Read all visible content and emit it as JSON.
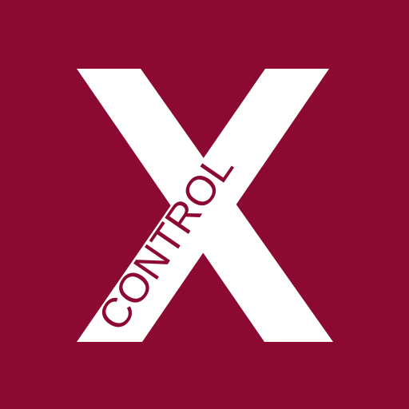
{
  "logo": {
    "word": "CONTROL",
    "background_color": "#8c0a32",
    "x_color": "#ffffff",
    "text_color": "#8c0a32"
  }
}
